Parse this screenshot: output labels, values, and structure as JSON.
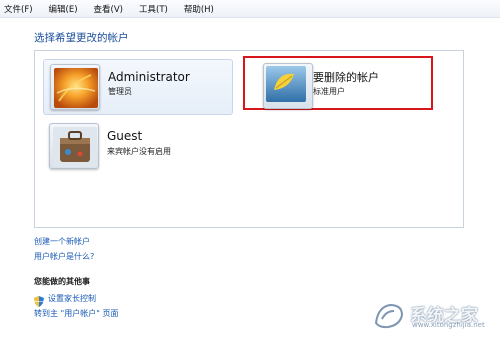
{
  "menubar": {
    "items": [
      {
        "label": "文件(F)"
      },
      {
        "label": "编辑(E)"
      },
      {
        "label": "查看(V)"
      },
      {
        "label": "工具(T)"
      },
      {
        "label": "帮助(H)"
      }
    ]
  },
  "heading": "选择希望更改的帐户",
  "accounts": [
    {
      "name": "Administrator",
      "role": "管理员"
    },
    {
      "name": "要删除的帐户",
      "role": "标准用户"
    },
    {
      "name": "Guest",
      "role": "来宾帐户没有启用"
    }
  ],
  "links": {
    "create_account": "创建一个新帐户",
    "what_is_account": "用户帐户是什么?"
  },
  "other_tasks": {
    "title": "您能做的其他事",
    "parental_controls": "设置家长控制",
    "goto_user_accounts": "转到主 \"用户帐户\" 页面"
  },
  "watermark": {
    "text": "系统之家",
    "url": "www.xitongzhijia.net"
  },
  "colors": {
    "link": "#1a5bb5",
    "heading": "#1a4f9c",
    "highlight_border": "#d8171c"
  }
}
